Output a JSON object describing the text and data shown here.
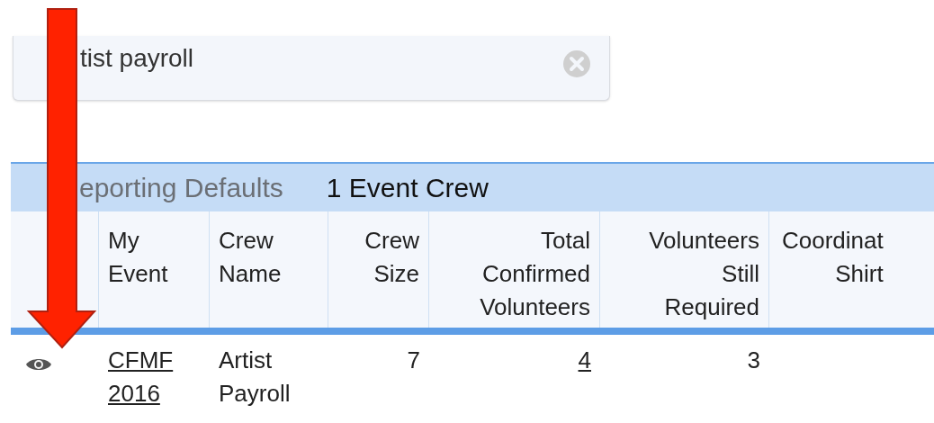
{
  "search": {
    "value": "tist payroll"
  },
  "table": {
    "toolbar": {
      "title": "eporting Defaults",
      "count": "1 Event Crew"
    },
    "columns": [
      {},
      {
        "label": "My\nEvent"
      },
      {
        "label": "Crew\nName"
      },
      {
        "label": "Crew\nSize"
      },
      {
        "label": "Total\nConfirmed\nVolunteers"
      },
      {
        "label": "Volunteers\nStill\nRequired"
      },
      {
        "label": "Coordinat\nShirt"
      }
    ],
    "rows": [
      {
        "cells": [
          {
            "kind": "view"
          },
          {
            "kind": "link",
            "text": "CFMF\n2016"
          },
          {
            "kind": "text",
            "text": "Artist\nPayroll"
          },
          {
            "kind": "text",
            "text": "7"
          },
          {
            "kind": "link",
            "text": "4"
          },
          {
            "kind": "text",
            "text": "3"
          }
        ]
      }
    ]
  }
}
